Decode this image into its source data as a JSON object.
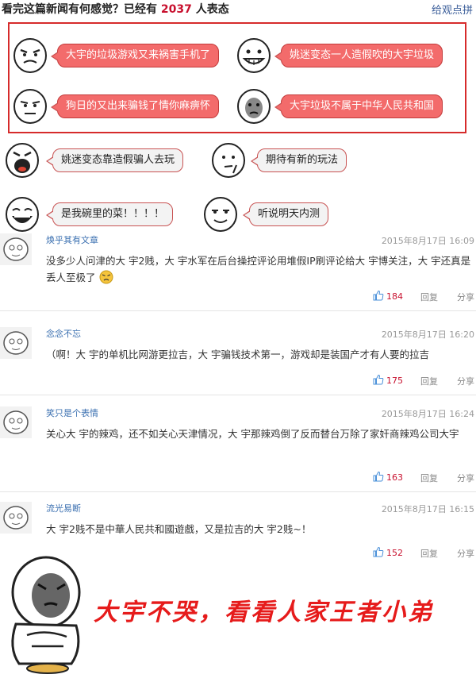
{
  "header": {
    "prefix": "看完这篇新闻有何感觉？已经有",
    "count": "2037",
    "suffix": "人表态",
    "link": "给观点拼"
  },
  "reactions": [
    {
      "label": "大宇的垃圾游戏又来祸害手机了"
    },
    {
      "label": "姚迷变态一人造假吹的大宇垃圾"
    },
    {
      "label": "狗日的又出来骗钱了情你麻痹怀"
    },
    {
      "label": "大宇垃圾不属于中华人民共和国"
    },
    {
      "label": "姚迷变态靠造假骗人去玩"
    },
    {
      "label": "期待有新的玩法"
    },
    {
      "label": "是我碗里的菜！！！！"
    },
    {
      "label": "听说明天内测"
    }
  ],
  "comments": [
    {
      "user": "焕乎其有文章",
      "time": "2015年8月17日 16:09",
      "text": "没多少人问津的大 宇2贱，大 宇水军在后台操控评论用堆假IP刷评论给大 宇博关注，大 宇还真是丢人至极了",
      "likes": "184",
      "reply": "回复",
      "share": "分享"
    },
    {
      "user": "念念不忘",
      "time": "2015年8月17日 16:20",
      "text": "（啊！大 宇的单机比网游更拉吉，大 宇骗钱技术第一，游戏却是装国产才有人要的拉吉",
      "likes": "175",
      "reply": "回复",
      "share": "分享"
    },
    {
      "user": "笑只是个表情",
      "time": "2015年8月17日 16:24",
      "text": "关心大 宇的辣鸡，还不如关心天津情况，大 宇那辣鸡倒了反而替台万除了家奸商辣鸡公司大宇",
      "likes": "163",
      "reply": "回复",
      "share": "分享"
    },
    {
      "user": "流光易断",
      "time": "2015年8月17日 16:15",
      "text": "大 宇2贱不是中華人民共和國遊戲，又是拉吉的大 宇2贱~！",
      "likes": "152",
      "reply": "回复",
      "share": "分享"
    }
  ],
  "footer": {
    "caption": "大宇不哭，看看人家王者小弟"
  },
  "colors": {
    "accent": "#c8102e",
    "link": "#3a6fb0",
    "bubble_hot": "#f36b6b",
    "box_border": "#d62b2b"
  }
}
